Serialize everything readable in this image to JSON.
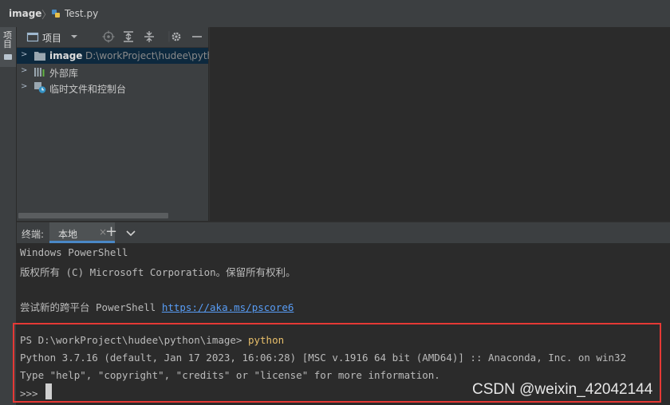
{
  "breadcrumb": {
    "root": "image",
    "file": "Test.py"
  },
  "stripe": {
    "label": "项目"
  },
  "project_panel": {
    "title": "项目",
    "tree": [
      {
        "name": "image",
        "path": "D:\\workProject\\hudee\\pyth",
        "selected": true
      },
      {
        "name": "外部库"
      },
      {
        "name": "临时文件和控制台"
      }
    ]
  },
  "terminal_bar": {
    "title": "终端:",
    "tab_label": "本地",
    "close": "×",
    "add": "+"
  },
  "terminal": {
    "line1": "Windows PowerShell",
    "line2": "版权所有 (C) Microsoft Corporation。保留所有权利。",
    "line4_prefix": "尝试新的跨平台 PowerShell ",
    "line4_link": "https://aka.ms/pscore6",
    "prompt": "PS D:\\workProject\\hudee\\python\\image> ",
    "command": "python",
    "python_banner": "Python 3.7.16 (default, Jan 17 2023, 16:06:28) [MSC v.1916 64 bit (AMD64)] :: Anaconda, Inc. on win32",
    "python_help": "Type \"help\", \"copyright\", \"credits\" or \"license\" for more information.",
    "repl_prompt": ">>> "
  },
  "watermark": "CSDN @weixin_42042144",
  "colors": {
    "background": "#2b2b2b",
    "panel": "#3c3f41",
    "link": "#589df6",
    "command": "#e8bf6a",
    "highlight": "#e53935",
    "selection": "#0d293e"
  }
}
